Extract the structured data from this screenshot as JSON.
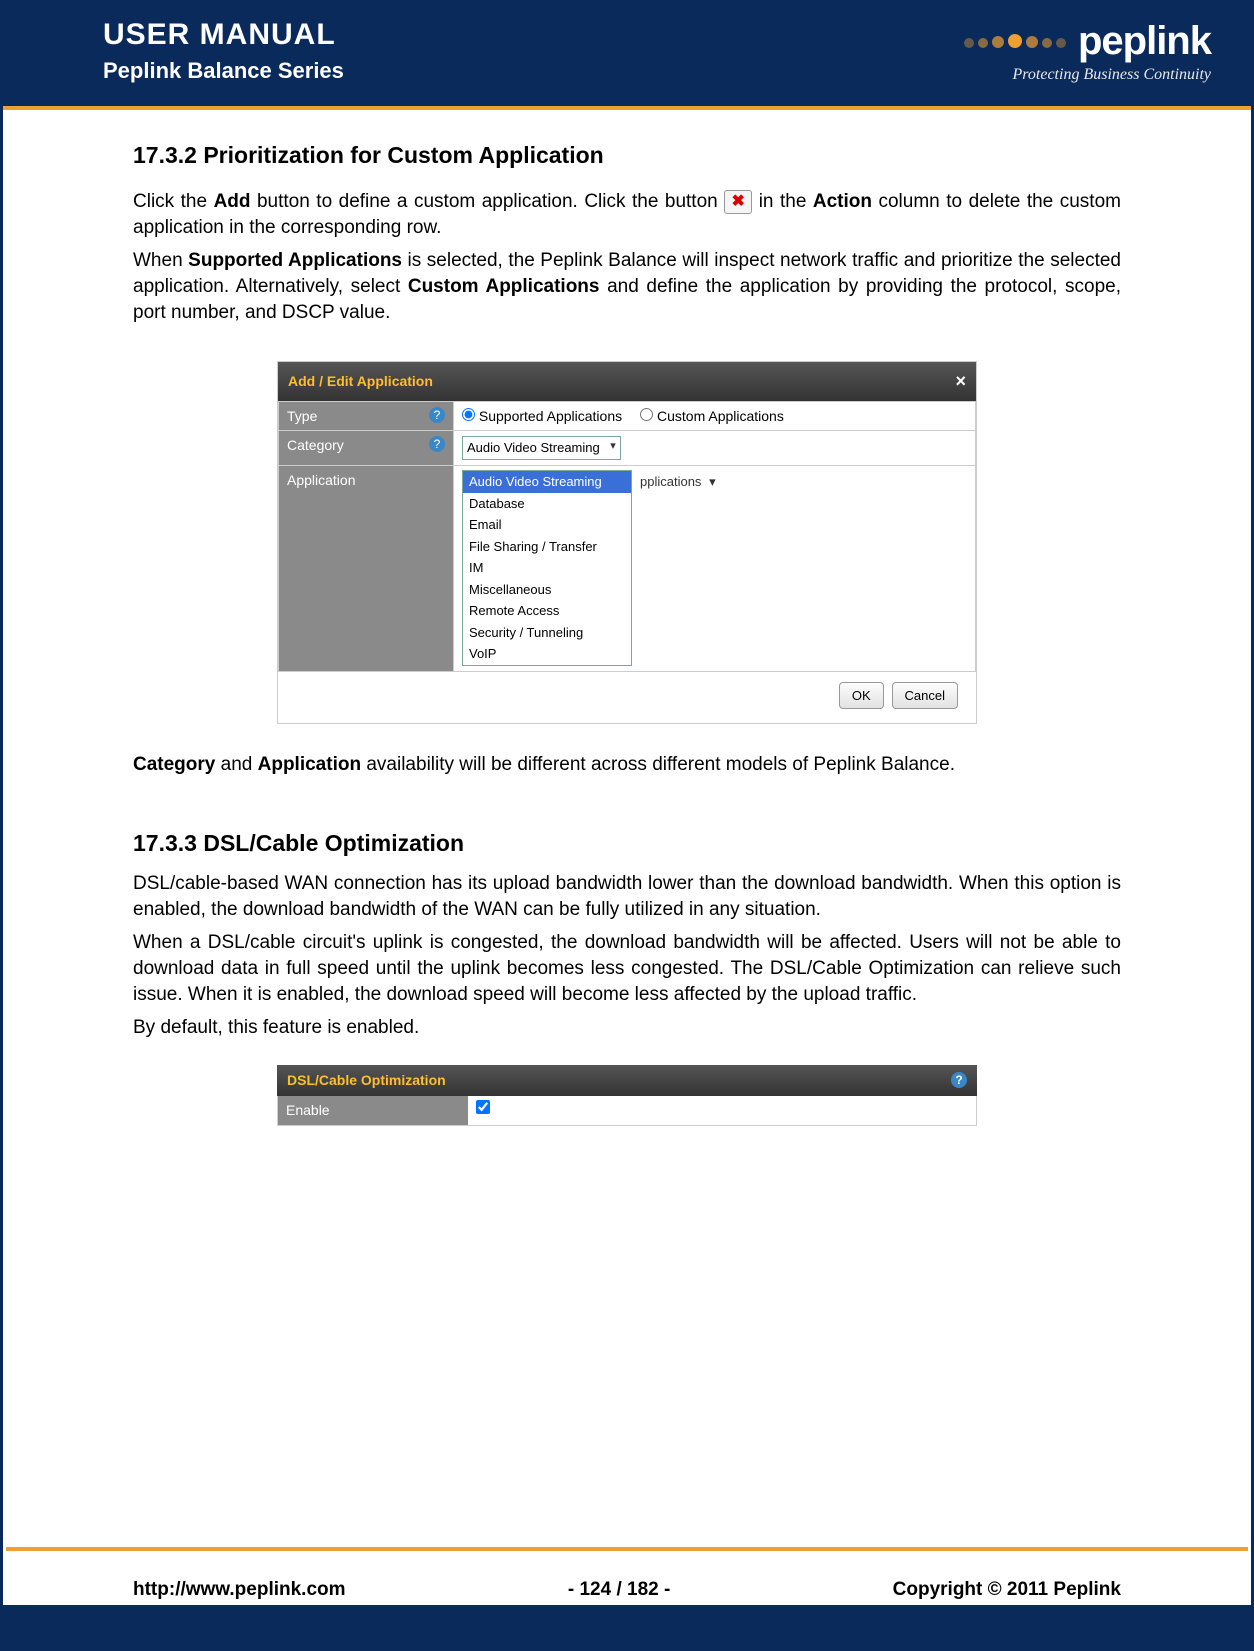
{
  "header": {
    "title": "USER MANUAL",
    "subtitle": "Peplink Balance Series",
    "brand": "peplink",
    "tagline": "Protecting Business Continuity"
  },
  "section1": {
    "heading": "17.3.2 Prioritization for Custom Application",
    "p1_a": "Click the ",
    "p1_b": "Add",
    "p1_c": " button to define a custom application.  Click the button ",
    "p1_d": " in the ",
    "p1_e": "Action",
    "p1_f": " column to delete the custom application in the corresponding row.",
    "p2_a": "When ",
    "p2_b": "Supported Applications",
    "p2_c": " is selected, the Peplink Balance will inspect network traffic and prioritize the selected application. Alternatively, select ",
    "p2_d": "Custom Applications",
    "p2_e": " and define the application by providing the protocol, scope, port number, and DSCP value.",
    "note_a": "Category",
    "note_b": " and ",
    "note_c": "Application",
    "note_d": " availability will be different across different models of Peplink Balance."
  },
  "dialog1": {
    "title": "Add / Edit Application",
    "close": "×",
    "rows": {
      "type": "Type",
      "category": "Category",
      "application": "Application"
    },
    "type_opts": {
      "supported": "Supported Applications",
      "custom": "Custom Applications"
    },
    "category_selected": "Audio Video Streaming",
    "category_options": [
      "Audio Video Streaming",
      "Database",
      "Email",
      "File Sharing / Transfer",
      "IM",
      "Miscellaneous",
      "Remote Access",
      "Security / Tunneling",
      "VoIP"
    ],
    "app_right": "pplications",
    "ok": "OK",
    "cancel": "Cancel"
  },
  "section2": {
    "heading": "17.3.3 DSL/Cable Optimization",
    "p1": "DSL/cable-based WAN connection has its upload bandwidth lower than the download bandwidth. When this option is enabled, the download bandwidth of the WAN can be fully utilized in any situation.",
    "p2": "When a DSL/cable circuit's uplink is congested, the download bandwidth will be affected. Users will not be able to download data in full speed until the uplink becomes less congested. The DSL/Cable Optimization can relieve such issue. When it is enabled, the download speed will become less affected by the upload traffic.",
    "p3": "By default, this feature is enabled."
  },
  "dialog2": {
    "title": "DSL/Cable Optimization",
    "enable_label": "Enable",
    "enable_checked": true
  },
  "footer": {
    "url": "http://www.peplink.com",
    "page": "- 124 / 182 -",
    "copyright": "Copyright © 2011 Peplink"
  },
  "icons": {
    "delete": "✖",
    "help": "?",
    "dropdown_arrow": "▾"
  }
}
